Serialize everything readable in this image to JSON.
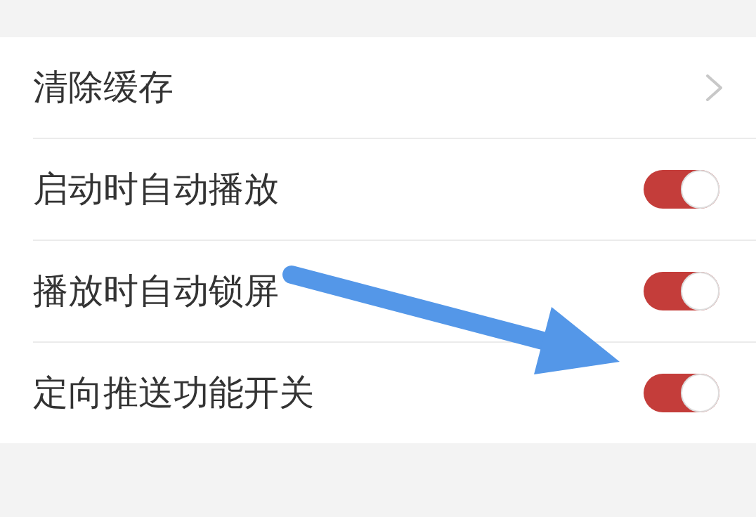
{
  "settings": {
    "items": [
      {
        "kind": "link",
        "label": "清除缓存"
      },
      {
        "kind": "toggle",
        "label": "启动时自动播放",
        "on": true
      },
      {
        "kind": "toggle",
        "label": "播放时自动锁屏",
        "on": true
      },
      {
        "kind": "toggle",
        "label": "定向推送功能开关",
        "on": true
      }
    ]
  }
}
